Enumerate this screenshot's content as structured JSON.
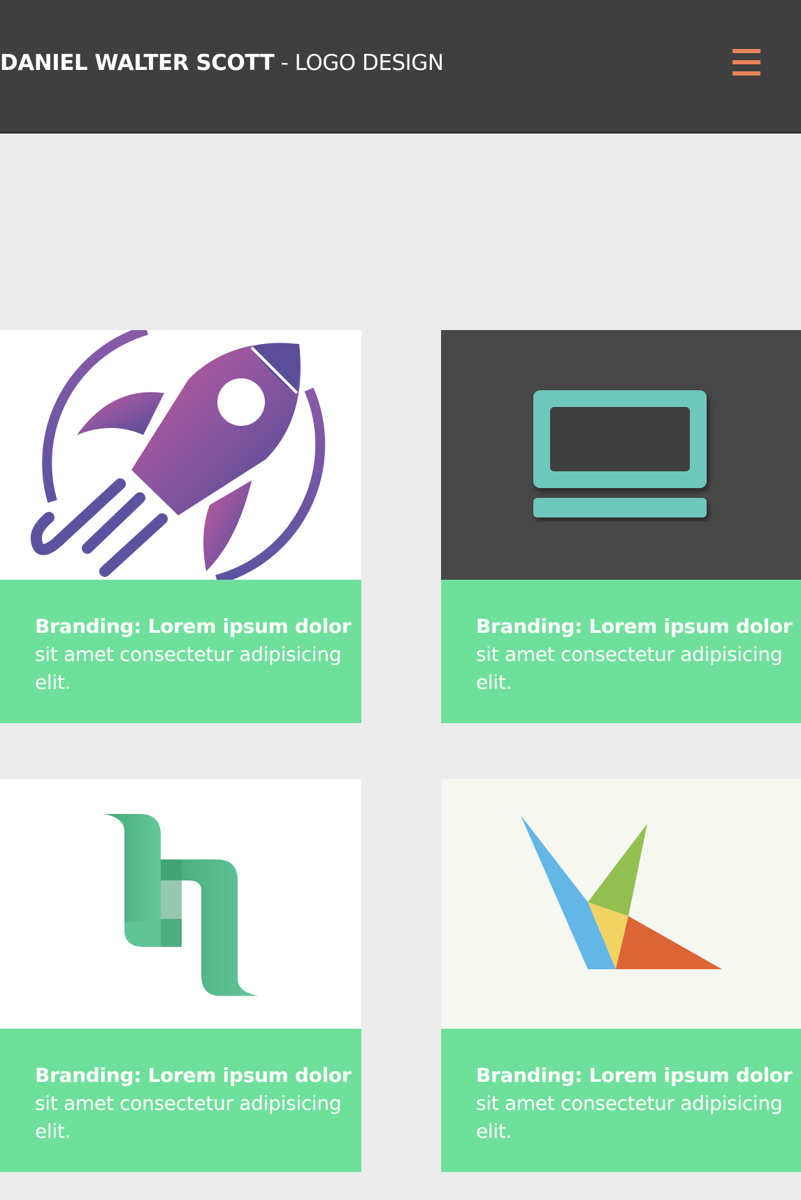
{
  "header": {
    "brand_name": "DANIEL WALTER SCOTT",
    "brand_separator": " - ",
    "brand_subtitle": "LOGO DESIGN",
    "menu_icon": "hamburger-menu-icon",
    "menu_color": "#e8845a"
  },
  "portfolio": {
    "items": [
      {
        "logo": "rocket-logo",
        "caption_lead": "Branding: Lorem ipsum dolor",
        "caption_rest": "sit amet consectetur adipisicing elit."
      },
      {
        "logo": "laptop-logo",
        "caption_lead": "Branding: Lorem ipsum dolor",
        "caption_rest": "sit amet consectetur adipisicing elit."
      },
      {
        "logo": "ribbon-letter-logo",
        "caption_lead": "Branding: Lorem ipsum dolor",
        "caption_rest": "sit amet consectetur adipisicing elit."
      },
      {
        "logo": "geometric-bird-logo",
        "caption_lead": "Branding: Lorem ipsum dolor",
        "caption_rest": "sit amet consectetur adipisicing elit."
      }
    ]
  },
  "colors": {
    "header_bg": "#3f3f3f",
    "page_bg": "#ececec",
    "caption_bg": "#6fe09c",
    "accent": "#e8845a"
  }
}
